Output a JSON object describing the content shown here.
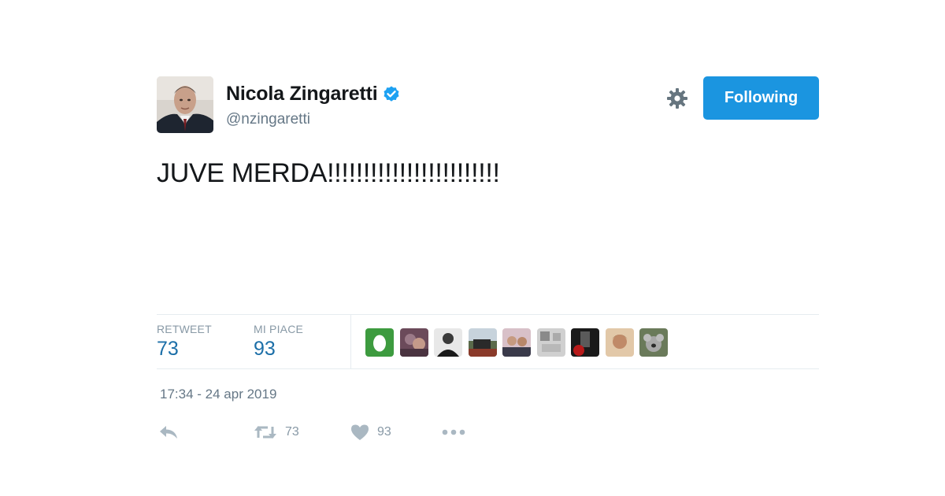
{
  "user": {
    "display_name": "Nicola Zingaretti",
    "handle": "@nzingaretti",
    "verified": true
  },
  "follow_button": {
    "label": "Following"
  },
  "tweet": {
    "text": "JUVE MERDA!!!!!!!!!!!!!!!!!!!!!!!!"
  },
  "stats": {
    "retweets_label": "RETWEET",
    "retweets_count": "73",
    "likes_label": "MI PIACE",
    "likes_count": "93"
  },
  "liker_avatars": [
    "egg",
    "photo",
    "photo",
    "photo",
    "photo",
    "photo",
    "photo",
    "photo",
    "photo"
  ],
  "timestamp": "17:34 - 24 apr 2019",
  "actions": {
    "retweet_count": "73",
    "like_count": "93"
  },
  "colors": {
    "accent": "#1b95e0",
    "muted": "#8899a6",
    "text": "#14171a",
    "verified": "#1da1f2"
  }
}
